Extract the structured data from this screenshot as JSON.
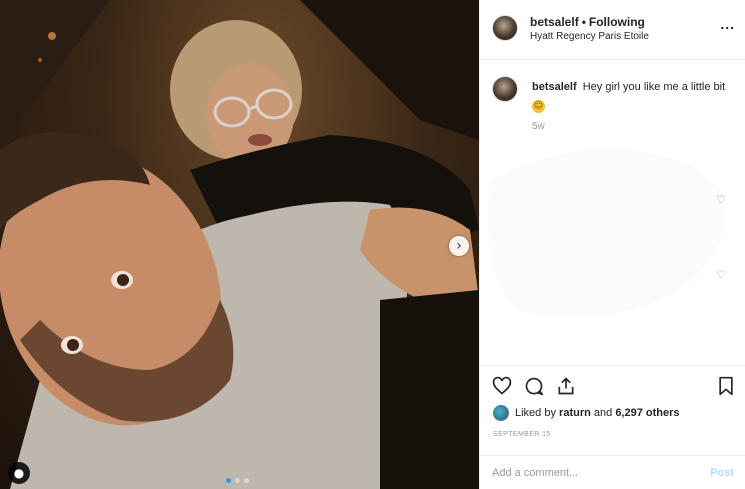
{
  "post": {
    "media_icons": {
      "next": "chevron-right-icon",
      "tagged": "user-tag-icon"
    },
    "carousel": {
      "count": 3,
      "active": 1
    }
  },
  "header": {
    "username": "betsalelf",
    "separator": "•",
    "follow_status": "Following",
    "location": "Hyatt Regency Paris Etoile",
    "more_label": "..."
  },
  "caption": {
    "username": "betsalelf",
    "text": "Hey girl you like me a little bit",
    "emoji": "smiling-face-emoji",
    "age": "5w"
  },
  "actions": {
    "icons": [
      "heart-icon",
      "comment-icon",
      "share-icon",
      "bookmark-icon"
    ]
  },
  "likes": {
    "prefix": "Liked by",
    "user": "raturn",
    "and": "and",
    "count_text": "6,297 others"
  },
  "date": "SEPTEMBER 15",
  "add_comment": {
    "placeholder": "Add a comment...",
    "post_label": "Post"
  },
  "colors": {
    "link_blue": "#3897f0",
    "post_disabled": "#b3dbff",
    "border": "#efefef"
  }
}
